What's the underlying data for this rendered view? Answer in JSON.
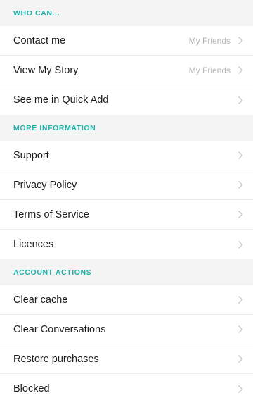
{
  "sections": [
    {
      "title": "WHO CAN...",
      "items": [
        {
          "label": "Contact me",
          "value": "My Friends"
        },
        {
          "label": "View My Story",
          "value": "My Friends"
        },
        {
          "label": "See me in Quick Add",
          "value": ""
        }
      ]
    },
    {
      "title": "MORE INFORMATION",
      "items": [
        {
          "label": "Support",
          "value": ""
        },
        {
          "label": "Privacy Policy",
          "value": ""
        },
        {
          "label": "Terms of Service",
          "value": ""
        },
        {
          "label": "Licences",
          "value": ""
        }
      ]
    },
    {
      "title": "ACCOUNT ACTIONS",
      "items": [
        {
          "label": "Clear cache",
          "value": ""
        },
        {
          "label": "Clear Conversations",
          "value": ""
        },
        {
          "label": "Restore purchases",
          "value": ""
        },
        {
          "label": "Blocked",
          "value": ""
        }
      ]
    }
  ],
  "icons": {
    "disclosure": "chevron-right-icon"
  },
  "colors": {
    "section_header_text": "#1fb2a9",
    "section_header_bg": "#f4f4f4",
    "value_text": "#b5b5b5",
    "chevron": "#c7c7cc"
  }
}
